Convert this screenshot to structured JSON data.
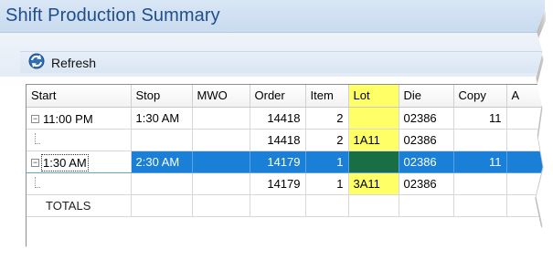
{
  "window": {
    "title": "Shift Production Summary"
  },
  "toolbar": {
    "refresh_label": "Refresh",
    "refresh_icon": "refresh-icon"
  },
  "grid": {
    "columns": [
      "Start",
      "Stop",
      "MWO",
      "Order",
      "Item",
      "Lot",
      "Die",
      "Copy",
      "A"
    ],
    "highlight_color": "#ffff66",
    "selection_color": "#1a7fd6",
    "rows": [
      {
        "start": "11:00 PM",
        "stop": "1:30 AM",
        "mwo": "",
        "order": "14418",
        "item": "2",
        "lot": "",
        "die": "02386",
        "copy": "11"
      },
      {
        "start": "",
        "stop": "",
        "mwo": "",
        "order": "14418",
        "item": "2",
        "lot": "1A11",
        "die": "02386",
        "copy": ""
      },
      {
        "start": "1:30 AM",
        "stop": "2:30 AM",
        "mwo": "",
        "order": "14179",
        "item": "1",
        "lot": "",
        "die": "02386",
        "copy": "11"
      },
      {
        "start": "",
        "stop": "",
        "mwo": "",
        "order": "14179",
        "item": "1",
        "lot": "3A11",
        "die": "02386",
        "copy": ""
      }
    ],
    "totals_label": "TOTALS"
  }
}
